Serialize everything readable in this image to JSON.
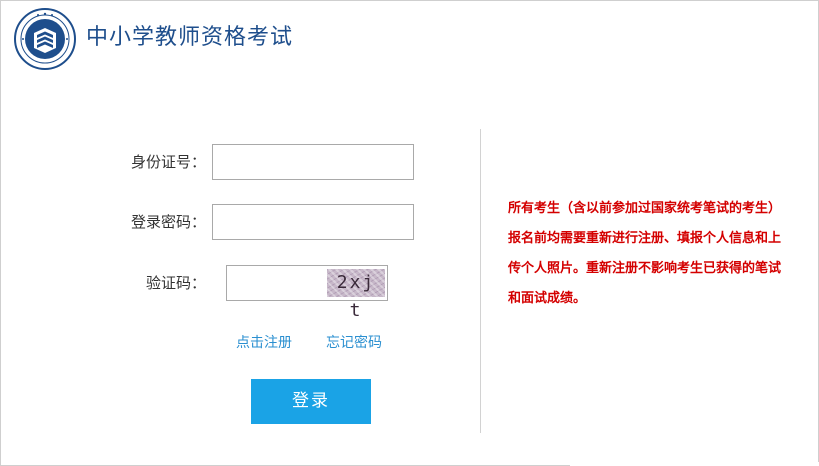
{
  "header": {
    "title": "中小学教师资格考试",
    "logo_icon": "book-seal-icon"
  },
  "form": {
    "id_label": "身份证号：",
    "id_value": "",
    "password_label": "登录密码：",
    "password_value": "",
    "captcha_label": "验证码：",
    "captcha_value": "",
    "captcha_text": "2xj t"
  },
  "links": {
    "register": "点击注册",
    "forgot_password": "忘记密码"
  },
  "login_button": "登录",
  "notice": "所有考生（含以前参加过国家统考笔试的考生）报名前均需要重新进行注册、填报个人信息和上传个人照片。重新注册不影响考生已获得的笔试和面试成绩。",
  "colors": {
    "title": "#1e4e8c",
    "link": "#2a8fd0",
    "button": "#1aa3e6",
    "notice": "#d40000"
  }
}
